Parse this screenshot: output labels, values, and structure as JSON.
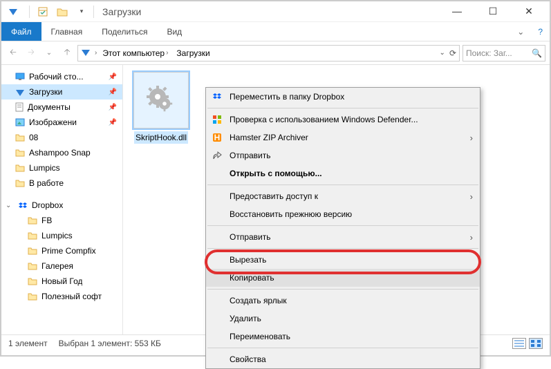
{
  "titlebar": {
    "title": "Загрузки"
  },
  "ribbon": {
    "file": "Файл",
    "home": "Главная",
    "share": "Поделиться",
    "view": "Вид"
  },
  "address": {
    "seg1": "Этот компьютер",
    "seg2": "Загрузки"
  },
  "search": {
    "placeholder": "Поиск: Заг..."
  },
  "nav": {
    "desktop": "Рабочий сто...",
    "downloads": "Загрузки",
    "documents": "Документы",
    "pictures": "Изображени",
    "f08": "08",
    "ashampoo": "Ashampoo Snap",
    "lumpics": "Lumpics",
    "inwork": "В работе",
    "dropbox": "Dropbox",
    "fb": "FB",
    "lumpics2": "Lumpics",
    "prime": "Prime Compfix",
    "gallery": "Галерея",
    "newyear": "Новый Год",
    "useful": "Полезный софт"
  },
  "file": {
    "name": "SkriptHook.dll"
  },
  "context": {
    "dropbox_move": "Переместить в папку Dropbox",
    "defender": "Проверка с использованием Windows Defender...",
    "hamster": "Hamster ZIP Archiver",
    "sendto": "Отправить",
    "openwith": "Открыть с помощью...",
    "grantaccess": "Предоставить доступ к",
    "restore": "Восстановить прежнюю версию",
    "sendto2": "Отправить",
    "cut": "Вырезать",
    "copy": "Копировать",
    "shortcut": "Создать ярлык",
    "delete": "Удалить",
    "rename": "Переименовать",
    "properties": "Свойства"
  },
  "status": {
    "count": "1 элемент",
    "selection": "Выбран 1 элемент: 553 КБ"
  }
}
